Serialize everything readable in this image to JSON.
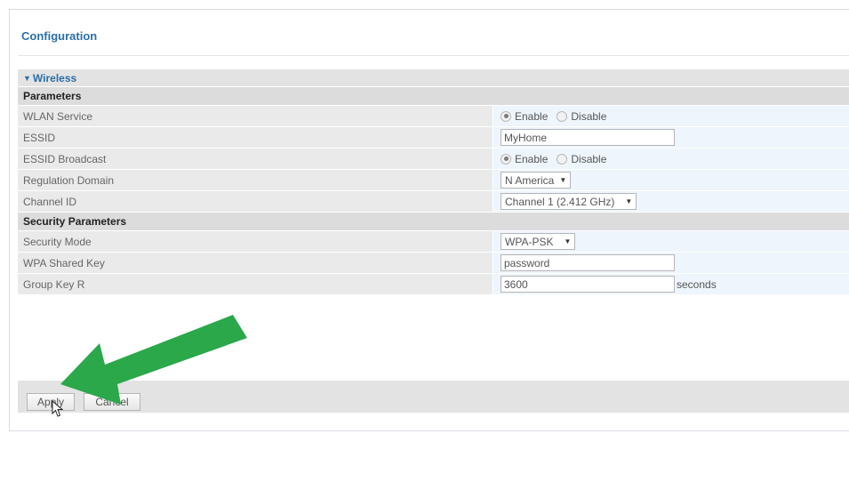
{
  "panel": {
    "title": "Configuration"
  },
  "wireless": {
    "section_label": "Wireless",
    "parameters_heading": "Parameters",
    "wlan_service": {
      "label": "WLAN Service",
      "options": [
        "Enable",
        "Disable"
      ],
      "selected": "Enable"
    },
    "essid": {
      "label": "ESSID",
      "value": "MyHome"
    },
    "essid_broadcast": {
      "label": "ESSID Broadcast",
      "options": [
        "Enable",
        "Disable"
      ],
      "selected": "Enable"
    },
    "regulation_domain": {
      "label": "Regulation Domain",
      "value": "N America"
    },
    "channel_id": {
      "label": "Channel ID",
      "value": "Channel 1 (2.412 GHz)"
    },
    "security_heading": "Security Parameters",
    "security_mode": {
      "label": "Security Mode",
      "value": "WPA-PSK"
    },
    "wpa_shared_key": {
      "label": "WPA Shared Key",
      "value": "password"
    },
    "group_key": {
      "label": "Group Key R",
      "value": "3600",
      "unit": "seconds"
    }
  },
  "actions": {
    "apply_label": "Apply",
    "cancel_label": "Cancel"
  },
  "overlay": {
    "arrow_color": "#2aa84a",
    "arrow_icon": "green-arrow-icon",
    "cursor_icon": "mouse-cursor-icon"
  },
  "colors": {
    "accent": "#2a6fa8",
    "value_bg": "#eef5fc",
    "label_bg": "#eaeaea"
  }
}
